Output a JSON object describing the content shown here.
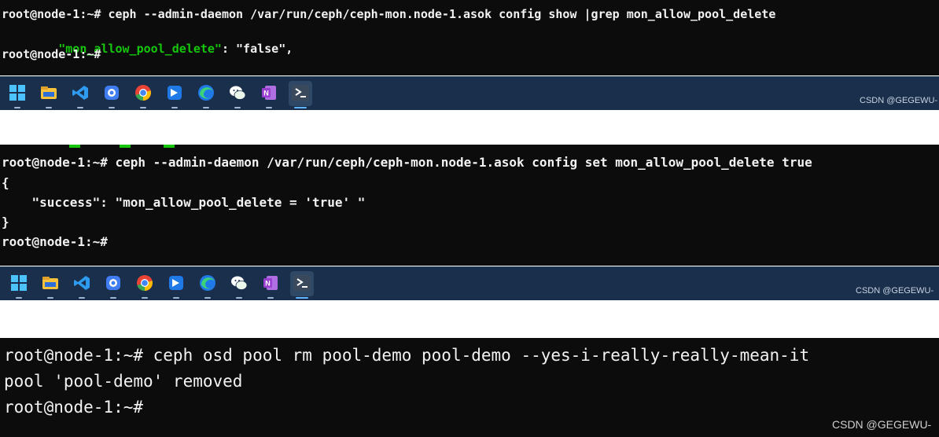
{
  "panel1": {
    "lines": [
      "root@node-1:~# ceph --admin-daemon /var/run/ceph/ceph-mon.node-1.asok config show |grep mon_allow_pool_delete",
      "root@node-1:~#"
    ],
    "json_line": {
      "indent": "    ",
      "key": "\"mon_allow_pool_delete\"",
      "rest": ": \"false\","
    }
  },
  "panel2": {
    "lines": [
      "root@node-1:~# ceph --admin-daemon /var/run/ceph/ceph-mon.node-1.asok config set mon_allow_pool_delete true",
      "{",
      "    \"success\": \"mon_allow_pool_delete = 'true' \"",
      "}",
      "root@node-1:~#"
    ]
  },
  "panel3": {
    "lines": [
      "root@node-1:~# ceph osd pool rm pool-demo pool-demo --yes-i-really-really-mean-it",
      "pool 'pool-demo' removed",
      "root@node-1:~#"
    ]
  },
  "watermark": "CSDN @GEGEWU-",
  "taskbar_icons": [
    {
      "name": "windows-start-icon",
      "color": "#4cc2ff"
    },
    {
      "name": "file-explorer-icon",
      "color": "#f8c33a"
    },
    {
      "name": "vscode-icon",
      "color": "#2f9bf0"
    },
    {
      "name": "app-icon",
      "color": "#3f7df0"
    },
    {
      "name": "chrome-icon",
      "color": "#e84335"
    },
    {
      "name": "app-blue-icon",
      "color": "#1f7ae8"
    },
    {
      "name": "edge-icon",
      "color": "#1bb0a3"
    },
    {
      "name": "wechat-icon",
      "color": "#ffffff"
    },
    {
      "name": "onenote-icon",
      "color": "#9b3fd1"
    },
    {
      "name": "terminal-icon",
      "color": "#3a4a5c"
    }
  ]
}
